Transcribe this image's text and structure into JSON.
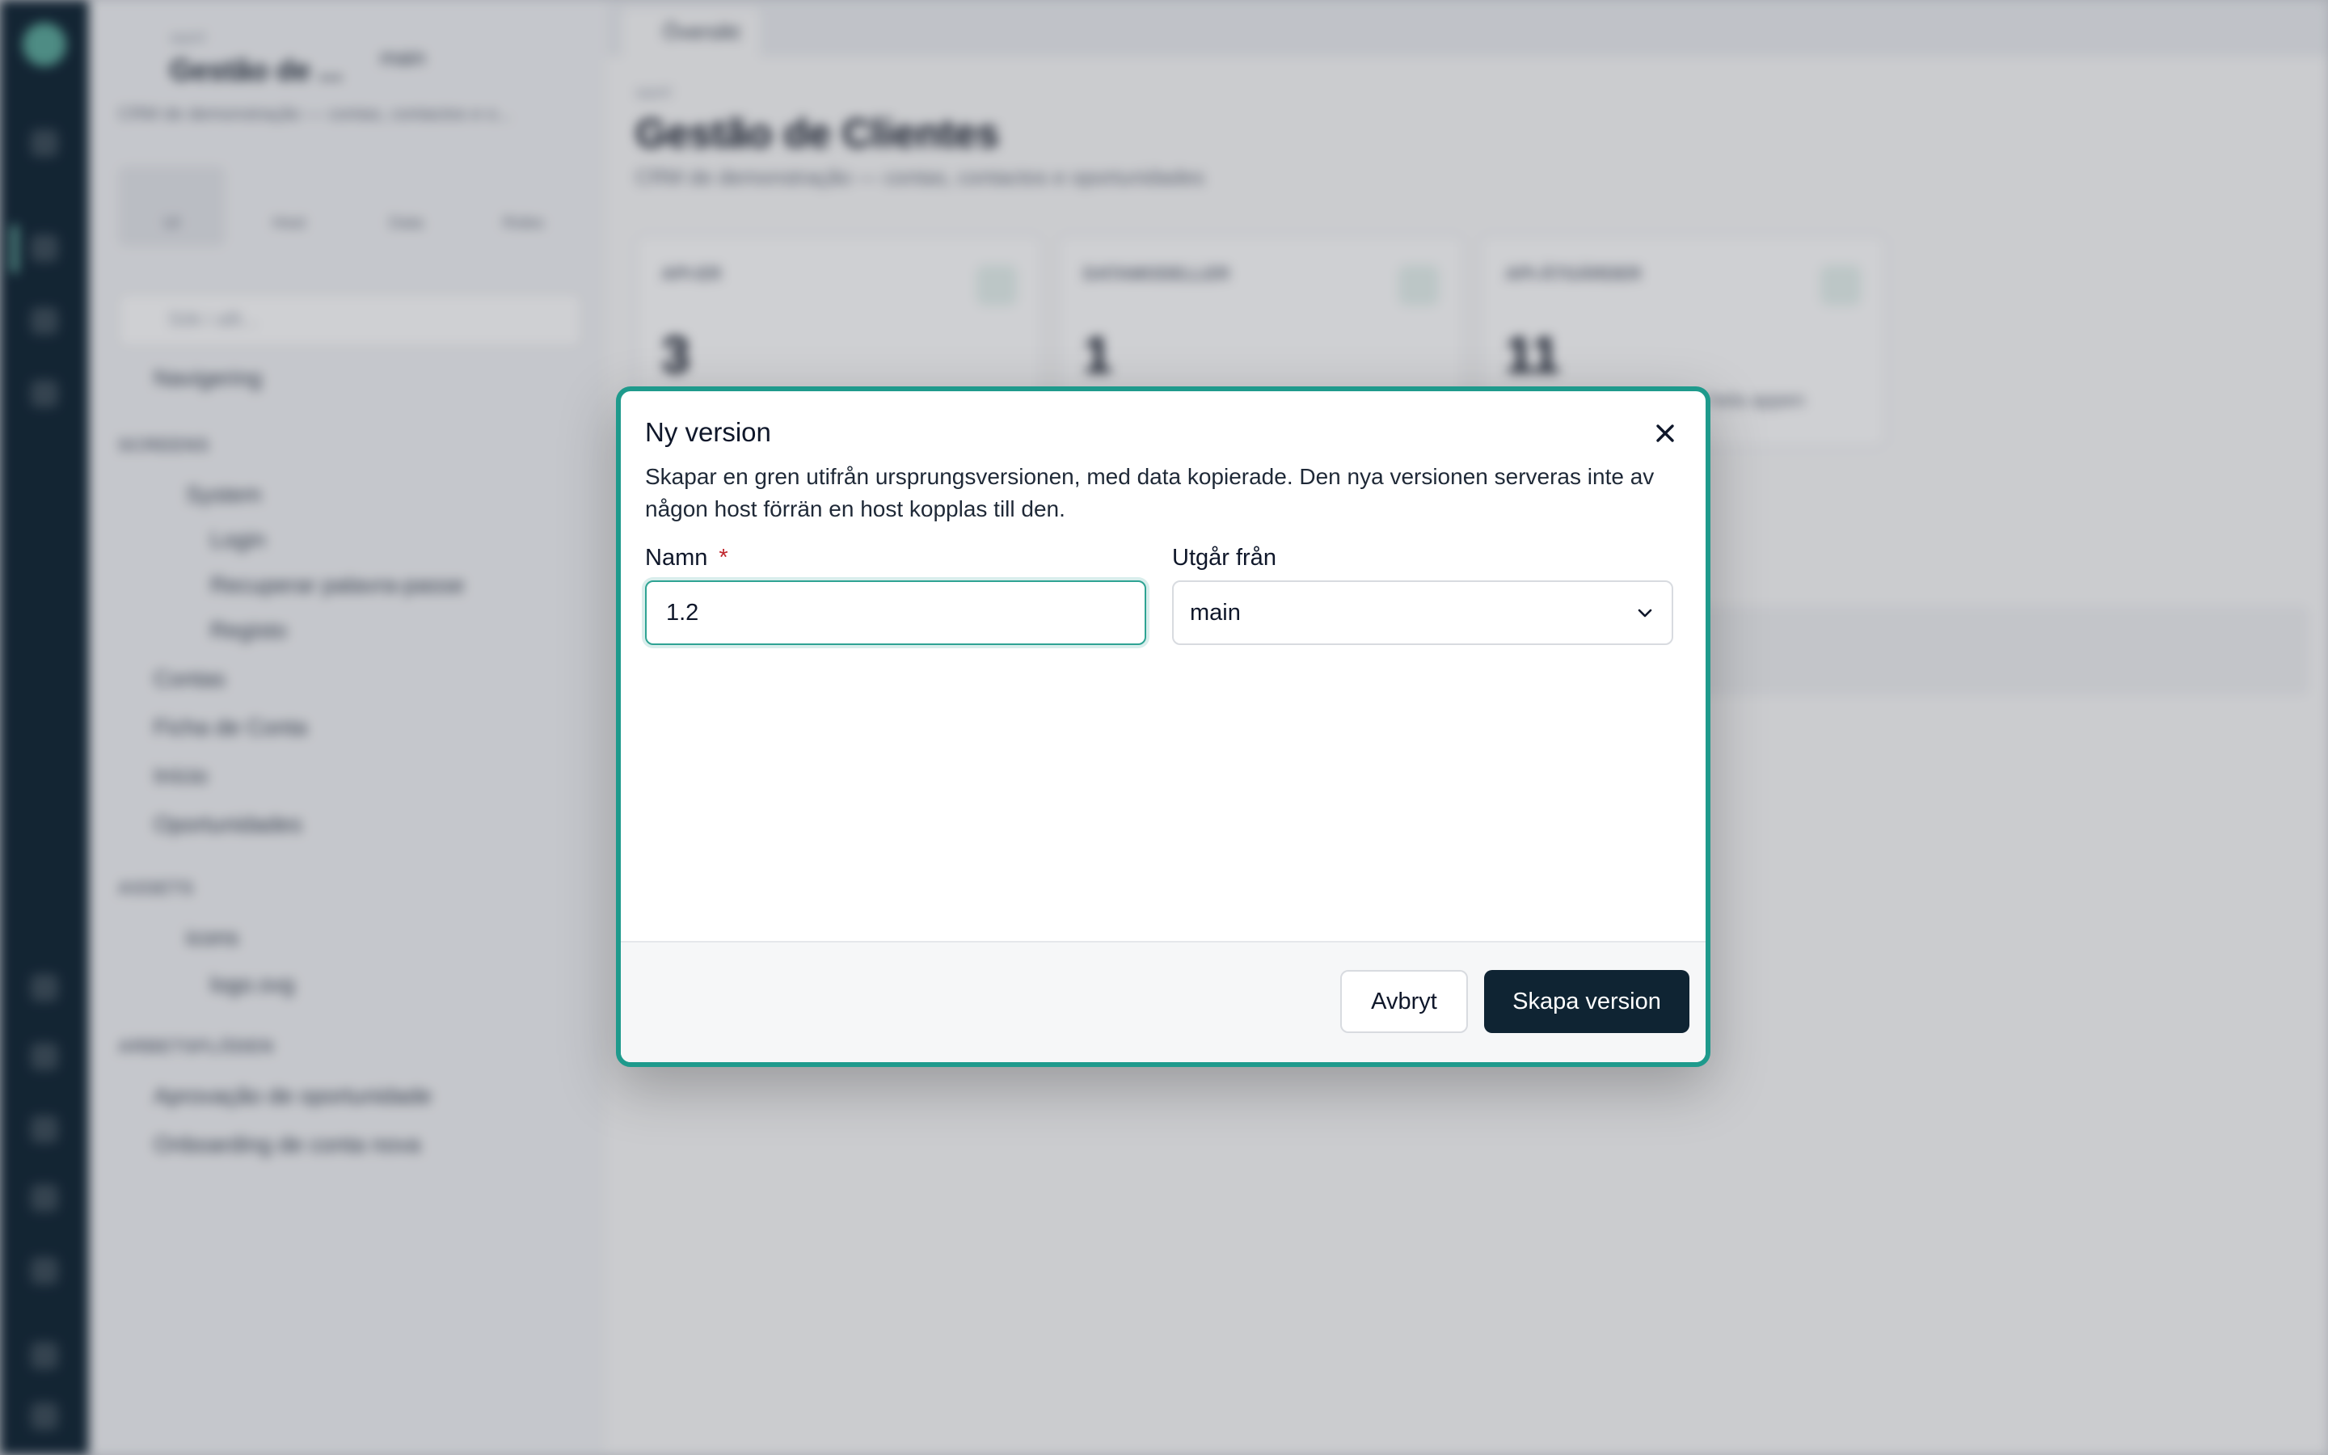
{
  "background": {
    "sidebar": {
      "small_label": "appid",
      "title": "Gestão de ...",
      "branch": "main",
      "subtitle": "CRM de demonstração — contas, contactos e o...",
      "tabs": [
        "UI",
        "Host",
        "Data",
        "Roles"
      ],
      "search_placeholder": "Sök i allt...",
      "nav_item": "Navigering",
      "section_screens": "SCREENS",
      "screens": [
        "System",
        "Login",
        "Recuperar palavra-passe",
        "Registo",
        "Contas",
        "Ficha de Conta",
        "Início",
        "Oportunidades"
      ],
      "section_assets": "ASSETS",
      "assets": [
        "icons",
        "logo.svg"
      ],
      "section_workflows": "ARBETSFLÖDEN",
      "workflows": [
        "Aprovação de oportunidade",
        "Onboarding de conta nova"
      ]
    },
    "main": {
      "tab": "Översikt",
      "crumb": "appid",
      "title": "Gestão de Clientes",
      "description": "CRM de demonstração — contas, contactos e oportunidades",
      "cards": [
        {
          "label": "API-ER",
          "value": "3"
        },
        {
          "label": "DATAMODELLER",
          "value": "1"
        },
        {
          "label": "API-ÅTGÄRDER",
          "value": "11",
          "note": "i hela appen"
        }
      ]
    }
  },
  "dialog": {
    "title": "Ny version",
    "description": "Skapar en gren utifrån ursprungsversionen, med data kopierade. Den nya versionen serveras inte av någon host förrän en host kopplas till den.",
    "name_label": "Namn",
    "required_mark": "*",
    "name_value": "1.2",
    "base_label": "Utgår från",
    "base_value": "main",
    "cancel_label": "Avbryt",
    "submit_label": "Skapa version"
  },
  "colors": {
    "accent": "#1e9a8c",
    "primary_button": "#0f2433",
    "required": "#c0262d"
  }
}
